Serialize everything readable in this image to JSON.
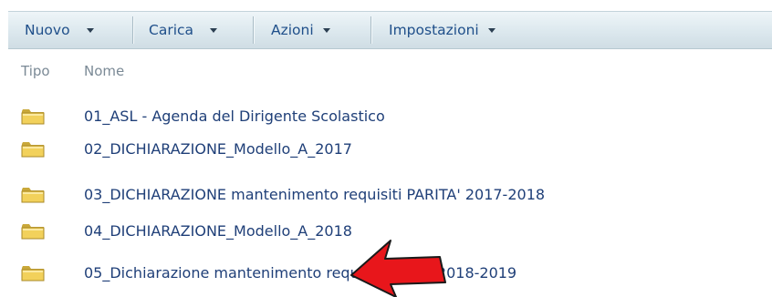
{
  "toolbar": {
    "new_label": "Nuovo",
    "upload_label": "Carica",
    "actions_label": "Azioni",
    "settings_label": "Impostazioni"
  },
  "list": {
    "columns": {
      "type": "Tipo",
      "name": "Nome"
    },
    "items": [
      {
        "name": "01_ASL - Agenda del Dirigente Scolastico",
        "icon": "folder-icon"
      },
      {
        "name": "02_DICHIARAZIONE_Modello_A_2017",
        "icon": "folder-icon"
      },
      {
        "name": "03_DICHIARAZIONE mantenimento requisiti PARITA' 2017-2018",
        "icon": "folder-icon"
      },
      {
        "name": "04_DICHIARAZIONE_Modello_A_2018",
        "icon": "folder-icon"
      },
      {
        "name": "05_Dichiarazione mantenimento requisiti parità 2018-2019",
        "icon": "folder-icon"
      }
    ]
  },
  "annotation": {
    "icon": "red-arrow-icon",
    "color": "#e8161b"
  },
  "colors": {
    "link": "#1f3f78",
    "toolbar_text": "#1f4f8a",
    "header_text": "#7b8a96",
    "folder": "#f2d15b"
  }
}
